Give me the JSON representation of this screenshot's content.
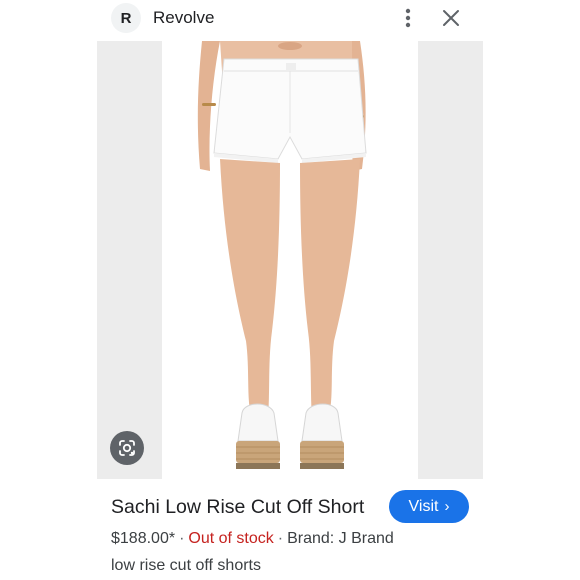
{
  "header": {
    "logo_letter": "R",
    "site_name": "Revolve"
  },
  "product": {
    "title": "Sachi Low Rise Cut Off Short",
    "visit_label": "Visit",
    "price": "$188.00*",
    "separator": "·",
    "stock_status": "Out of stock",
    "brand": "Brand: J Brand",
    "description": "low rise cut off shorts"
  },
  "icons": {
    "more": "more-vert-icon",
    "close": "close-icon",
    "lens": "google-lens-icon",
    "visit_chevron": "chevron-right-icon"
  },
  "colors": {
    "accent": "#1a73e8",
    "stock": "#c5221f",
    "image_bg": "#ececec"
  }
}
